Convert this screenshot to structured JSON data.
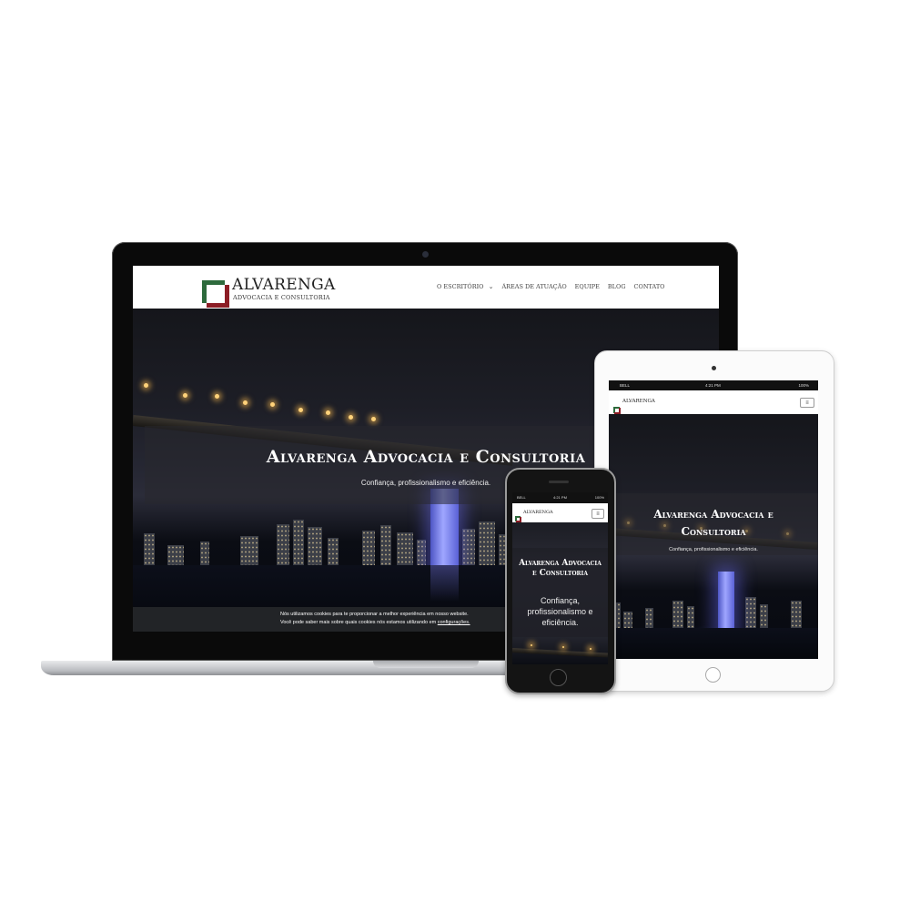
{
  "brand": {
    "name": "ALVARENGA",
    "tagline": "ADVOCACIA E CONSULTORIA",
    "green": "#2d6a3c",
    "red": "#8c1d25"
  },
  "nav": {
    "items": [
      {
        "label": "O ESCRITÓRIO"
      },
      {
        "label": "ÁREAS DE ATUAÇÃO"
      },
      {
        "label": "EQUIPE"
      },
      {
        "label": "BLOG"
      },
      {
        "label": "CONTATO"
      }
    ],
    "dropdown_icon": "chevron-down-icon",
    "menu_icon": "hamburger-icon"
  },
  "hero": {
    "title": "Alvarenga Advocacia e Consultoria",
    "subtitle": "Confiança, profissionalismo e eficiência."
  },
  "cookie": {
    "line1": "Nós utilizamos cookies para te proporcionar a melhor experiência em nosso website.",
    "line2": "Você pode saber mais sobre quais cookies nós estamos utilizando em",
    "link": "configurações."
  },
  "status": {
    "carrier": "BELL",
    "time": "4:21 PM",
    "battery": "100%"
  }
}
